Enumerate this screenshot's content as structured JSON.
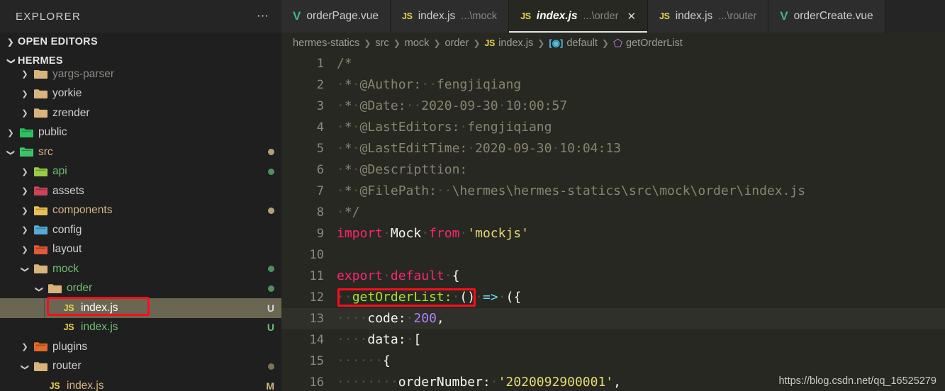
{
  "sidebar": {
    "title": "EXPLORER",
    "more_icon": "ellipsis-icon",
    "sections": [
      {
        "label": "OPEN EDITORS",
        "expanded": false
      },
      {
        "label": "HERMES",
        "expanded": true
      }
    ],
    "tree": [
      {
        "label": "yargs-parser",
        "type": "folder",
        "depth": 2,
        "twisty": "collapsed",
        "icon": "folder-icon",
        "color": "#8a8a84",
        "badge": "",
        "dot": ""
      },
      {
        "label": "yorkie",
        "type": "folder",
        "depth": 2,
        "twisty": "collapsed",
        "icon": "folder-icon",
        "color": "#cfcfcf",
        "badge": "",
        "dot": ""
      },
      {
        "label": "zrender",
        "type": "folder",
        "depth": 2,
        "twisty": "collapsed",
        "icon": "folder-icon",
        "color": "#cfcfcf",
        "badge": "",
        "dot": ""
      },
      {
        "label": "public",
        "type": "folder",
        "depth": 1,
        "twisty": "collapsed",
        "icon": "folder-public-icon",
        "color": "#cfcfcf",
        "badge": "",
        "dot": ""
      },
      {
        "label": "src",
        "type": "folder",
        "depth": 1,
        "twisty": "expanded",
        "icon": "folder-src-icon",
        "color": "#d4b483",
        "badge": "",
        "dot": "#b2a07c"
      },
      {
        "label": "api",
        "type": "folder",
        "depth": 2,
        "twisty": "collapsed",
        "icon": "folder-api-icon",
        "color": "#6fbf73",
        "badge": "",
        "dot": "#4f8f63"
      },
      {
        "label": "assets",
        "type": "folder",
        "depth": 2,
        "twisty": "collapsed",
        "icon": "folder-assets-icon",
        "color": "#cfcfcf",
        "badge": "",
        "dot": ""
      },
      {
        "label": "components",
        "type": "folder",
        "depth": 2,
        "twisty": "collapsed",
        "icon": "folder-components-icon",
        "color": "#d4b483",
        "badge": "",
        "dot": "#b2a07c"
      },
      {
        "label": "config",
        "type": "folder",
        "depth": 2,
        "twisty": "collapsed",
        "icon": "folder-config-icon",
        "color": "#cfcfcf",
        "badge": "",
        "dot": ""
      },
      {
        "label": "layout",
        "type": "folder",
        "depth": 2,
        "twisty": "collapsed",
        "icon": "folder-layout-icon",
        "color": "#cfcfcf",
        "badge": "",
        "dot": ""
      },
      {
        "label": "mock",
        "type": "folder",
        "depth": 2,
        "twisty": "expanded",
        "icon": "folder-icon",
        "color": "#6fbf73",
        "badge": "",
        "dot": "#4f8f63"
      },
      {
        "label": "order",
        "type": "folder",
        "depth": 3,
        "twisty": "expanded",
        "icon": "folder-icon",
        "color": "#6fbf73",
        "badge": "",
        "dot": "#4f8f63"
      },
      {
        "label": "index.js",
        "type": "file",
        "depth": 4,
        "twisty": "blank",
        "icon": "js-file-icon",
        "color": "#ffffff",
        "badge": "U",
        "badge_color": "#d8d8d8",
        "dot": "",
        "selected": true
      },
      {
        "label": "index.js",
        "type": "file",
        "depth": 4,
        "twisty": "blank",
        "icon": "js-file-icon",
        "color": "#6fbf73",
        "badge": "U",
        "badge_color": "#6fbf73",
        "dot": ""
      },
      {
        "label": "plugins",
        "type": "folder",
        "depth": 2,
        "twisty": "collapsed",
        "icon": "folder-plugins-icon",
        "color": "#cfcfcf",
        "badge": "",
        "dot": ""
      },
      {
        "label": "router",
        "type": "folder",
        "depth": 2,
        "twisty": "expanded",
        "icon": "folder-icon",
        "color": "#cfcfcf",
        "badge": "",
        "dot": "#7d7259"
      },
      {
        "label": "index.js",
        "type": "file",
        "depth": 3,
        "twisty": "blank",
        "icon": "js-file-icon",
        "color": "#d4b483",
        "badge": "M",
        "badge_color": "#d4b483",
        "dot": ""
      }
    ]
  },
  "tabs": [
    {
      "name": "orderPage.vue",
      "path": "",
      "icon": "vue-file-icon",
      "active": false,
      "closeable": false
    },
    {
      "name": "index.js",
      "path": "...\\mock",
      "icon": "js-file-icon",
      "active": false,
      "closeable": false
    },
    {
      "name": "index.js",
      "path": "...\\order",
      "icon": "js-file-icon",
      "active": true,
      "closeable": true,
      "close_icon": "close-icon"
    },
    {
      "name": "index.js",
      "path": "...\\router",
      "icon": "js-file-icon",
      "active": false,
      "closeable": false
    },
    {
      "name": "orderCreate.vue",
      "path": "",
      "icon": "vue-file-icon",
      "active": false,
      "closeable": false
    }
  ],
  "breadcrumb": [
    {
      "label": "hermes-statics",
      "icon": ""
    },
    {
      "label": "src",
      "icon": ""
    },
    {
      "label": "mock",
      "icon": ""
    },
    {
      "label": "order",
      "icon": ""
    },
    {
      "label": "index.js",
      "icon": "js-file-icon"
    },
    {
      "label": "default",
      "icon": "module-symbol-icon"
    },
    {
      "label": "getOrderList",
      "icon": "method-symbol-icon"
    }
  ],
  "code": {
    "lines": [
      {
        "num": 1,
        "current": false,
        "tokens": [
          {
            "t": "/*",
            "c": "c-comment"
          }
        ]
      },
      {
        "num": 2,
        "current": false,
        "tokens": [
          {
            "t": "·",
            "c": "ws"
          },
          {
            "t": "*",
            "c": "c-comment"
          },
          {
            "t": "·",
            "c": "ws"
          },
          {
            "t": "@Author:",
            "c": "c-comment"
          },
          {
            "t": "··",
            "c": "ws"
          },
          {
            "t": "fengjiqiang",
            "c": "c-comment"
          }
        ]
      },
      {
        "num": 3,
        "current": false,
        "tokens": [
          {
            "t": "·",
            "c": "ws"
          },
          {
            "t": "*",
            "c": "c-comment"
          },
          {
            "t": "·",
            "c": "ws"
          },
          {
            "t": "@Date:",
            "c": "c-comment"
          },
          {
            "t": "··",
            "c": "ws"
          },
          {
            "t": "2020-09-30",
            "c": "c-comment"
          },
          {
            "t": "·",
            "c": "ws"
          },
          {
            "t": "10:00:57",
            "c": "c-comment"
          }
        ]
      },
      {
        "num": 4,
        "current": false,
        "tokens": [
          {
            "t": "·",
            "c": "ws"
          },
          {
            "t": "*",
            "c": "c-comment"
          },
          {
            "t": "·",
            "c": "ws"
          },
          {
            "t": "@LastEditors:",
            "c": "c-comment"
          },
          {
            "t": "·",
            "c": "ws"
          },
          {
            "t": "fengjiqiang",
            "c": "c-comment"
          }
        ]
      },
      {
        "num": 5,
        "current": false,
        "tokens": [
          {
            "t": "·",
            "c": "ws"
          },
          {
            "t": "*",
            "c": "c-comment"
          },
          {
            "t": "·",
            "c": "ws"
          },
          {
            "t": "@LastEditTime:",
            "c": "c-comment"
          },
          {
            "t": "·",
            "c": "ws"
          },
          {
            "t": "2020-09-30",
            "c": "c-comment"
          },
          {
            "t": "·",
            "c": "ws"
          },
          {
            "t": "10:04:13",
            "c": "c-comment"
          }
        ]
      },
      {
        "num": 6,
        "current": false,
        "tokens": [
          {
            "t": "·",
            "c": "ws"
          },
          {
            "t": "*",
            "c": "c-comment"
          },
          {
            "t": "·",
            "c": "ws"
          },
          {
            "t": "@Descripttion:",
            "c": "c-comment"
          }
        ]
      },
      {
        "num": 7,
        "current": false,
        "tokens": [
          {
            "t": "·",
            "c": "ws"
          },
          {
            "t": "*",
            "c": "c-comment"
          },
          {
            "t": "·",
            "c": "ws"
          },
          {
            "t": "@FilePath:",
            "c": "c-comment"
          },
          {
            "t": "··",
            "c": "ws"
          },
          {
            "t": "\\hermes\\hermes-statics\\src\\mock\\order\\index.js",
            "c": "c-comment"
          }
        ]
      },
      {
        "num": 8,
        "current": false,
        "tokens": [
          {
            "t": "·",
            "c": "ws"
          },
          {
            "t": "*/",
            "c": "c-comment"
          }
        ]
      },
      {
        "num": 9,
        "current": false,
        "tokens": [
          {
            "t": "import",
            "c": "c-key"
          },
          {
            "t": "·",
            "c": "ws"
          },
          {
            "t": "Mock",
            "c": "c-plain"
          },
          {
            "t": "·",
            "c": "ws"
          },
          {
            "t": "from",
            "c": "c-key"
          },
          {
            "t": "·",
            "c": "ws"
          },
          {
            "t": "'mockjs'",
            "c": "c-str"
          }
        ]
      },
      {
        "num": 10,
        "current": false,
        "tokens": []
      },
      {
        "num": 11,
        "current": false,
        "tokens": [
          {
            "t": "export",
            "c": "c-key"
          },
          {
            "t": "·",
            "c": "ws"
          },
          {
            "t": "default",
            "c": "c-key"
          },
          {
            "t": "·",
            "c": "ws"
          },
          {
            "t": "{",
            "c": "c-plain"
          }
        ]
      },
      {
        "num": 12,
        "current": false,
        "tokens": [
          {
            "t": "··",
            "c": "ws"
          },
          {
            "t": "getOrderList:",
            "c": "c-fn"
          },
          {
            "t": "·",
            "c": "ws"
          },
          {
            "t": "()",
            "c": "c-plain"
          },
          {
            "t": "·",
            "c": "ws"
          },
          {
            "t": "=>",
            "c": "c-arrow"
          },
          {
            "t": "·",
            "c": "ws"
          },
          {
            "t": "({",
            "c": "c-plain"
          }
        ]
      },
      {
        "num": 13,
        "current": true,
        "tokens": [
          {
            "t": "····",
            "c": "ws"
          },
          {
            "t": "code:",
            "c": "c-prop"
          },
          {
            "t": "·",
            "c": "ws"
          },
          {
            "t": "200",
            "c": "c-num"
          },
          {
            "t": ",",
            "c": "c-plain"
          }
        ]
      },
      {
        "num": 14,
        "current": false,
        "tokens": [
          {
            "t": "····",
            "c": "ws"
          },
          {
            "t": "data:",
            "c": "c-prop"
          },
          {
            "t": "·",
            "c": "ws"
          },
          {
            "t": "[",
            "c": "c-plain"
          }
        ]
      },
      {
        "num": 15,
        "current": false,
        "tokens": [
          {
            "t": "······",
            "c": "ws"
          },
          {
            "t": "{",
            "c": "c-plain"
          }
        ]
      },
      {
        "num": 16,
        "current": false,
        "tokens": [
          {
            "t": "········",
            "c": "ws"
          },
          {
            "t": "orderNumber:",
            "c": "c-prop"
          },
          {
            "t": "·",
            "c": "ws"
          },
          {
            "t": "'2020092900001'",
            "c": "c-str"
          },
          {
            "t": ",",
            "c": "c-plain"
          }
        ]
      }
    ]
  },
  "watermark": "https://blog.csdn.net/qq_16525279",
  "colors": {
    "annotation_red": "#fc0d1b",
    "editor_bg": "#272822",
    "sidebar_bg": "#1f1f1f",
    "selected_row": "#6b6652"
  }
}
